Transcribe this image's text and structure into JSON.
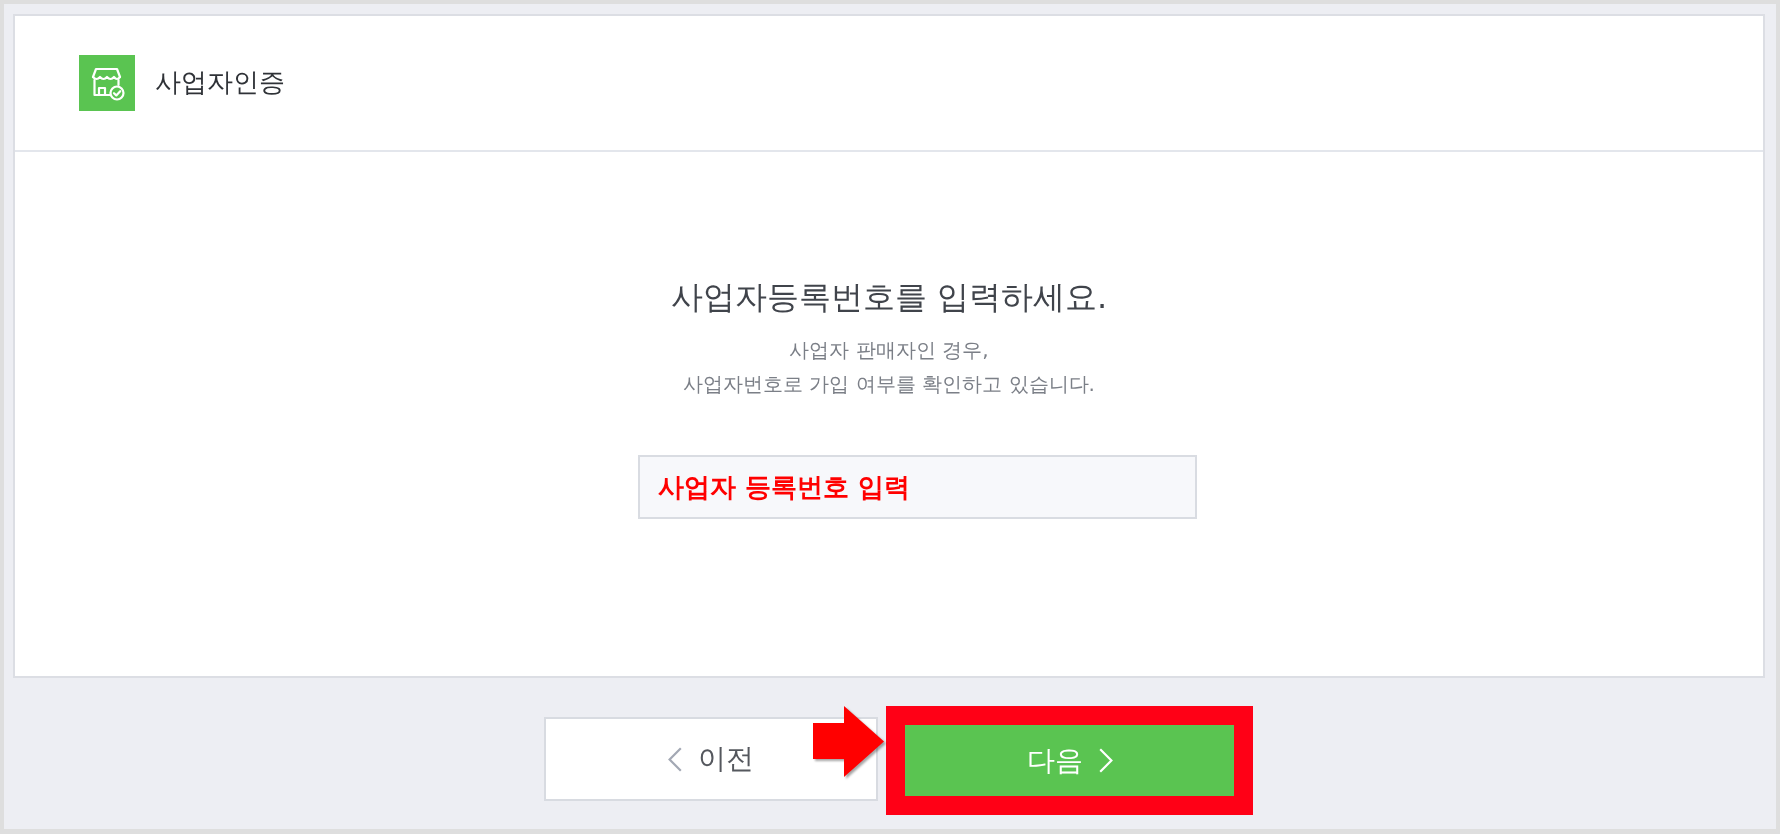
{
  "header": {
    "title": "사업자인증"
  },
  "heading": "사업자등록번호를 입력하세요.",
  "description": "사업자 판매자인 경우,\n사업자번호로 가입 여부를 확인하고 있습니다.",
  "business_number_field": {
    "placeholder": "사업자 등록번호 입력"
  },
  "buttons": [
    {
      "kind": "back",
      "label": "이전",
      "highlighted": false
    },
    {
      "kind": "next",
      "label": "다음",
      "highlighted": true
    }
  ]
}
